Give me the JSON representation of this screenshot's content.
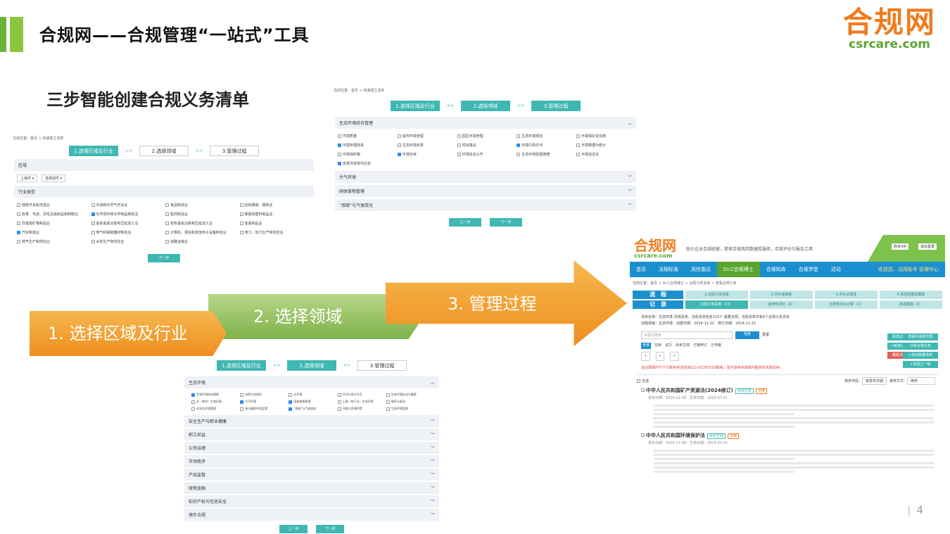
{
  "header": {
    "title": "合规网——合规管理“一站式”工具",
    "logo_cn": "合规网",
    "logo_en": "csrcare.com"
  },
  "subtitle": "三步智能创建合规义务清单",
  "page_number": "4",
  "chevrons": [
    "1. 选择区域及行业",
    "2. 选择领域",
    "3. 管理过程"
  ],
  "wizard": {
    "crumb": "当前位置：首页 > 快速建立清单",
    "steps": [
      "1.选择区域及行业",
      "2.选择领域",
      "3.管理过程"
    ],
    "arrow": ">>",
    "btn_prev": "上一步",
    "btn_next": "下一步"
  },
  "shot1": {
    "region_label": "区域",
    "province": "上海市",
    "city_placeholder": "选择城市",
    "industry_label": "行业类型",
    "industries": [
      {
        "label": "煤炭开采和洗选业",
        "checked": false
      },
      {
        "label": "石油和天然气开采业",
        "checked": false
      },
      {
        "label": "食品制造业",
        "checked": false
      },
      {
        "label": "纺织服装、服饰业",
        "checked": false
      },
      {
        "label": "皮革、毛皮、羽毛及其制品和制鞋业",
        "checked": false
      },
      {
        "label": "化学原料和化学制品制造业",
        "checked": true
      },
      {
        "label": "医药制造业",
        "checked": false
      },
      {
        "label": "橡胶和塑料制品业",
        "checked": false
      },
      {
        "label": "非金属矿物制品业",
        "checked": false
      },
      {
        "label": "黑色金属冶炼和压延加工业",
        "checked": false
      },
      {
        "label": "有色金属冶炼和压延加工业",
        "checked": false
      },
      {
        "label": "金属制品业",
        "checked": false
      },
      {
        "label": "汽车制造业",
        "checked": true
      },
      {
        "label": "电气机械和器材制造业",
        "checked": false
      },
      {
        "label": "计算机、通信和其他电子设备制造业",
        "checked": false
      },
      {
        "label": "电力、热力生产和供应业",
        "checked": false
      },
      {
        "label": "燃气生产和供应业",
        "checked": false
      },
      {
        "label": "水的生产和供应业",
        "checked": false
      },
      {
        "label": "道路运输业",
        "checked": false
      }
    ]
  },
  "shot2": {
    "sections": [
      "生态环境综合管理",
      "大气环境",
      "固体废物管理",
      "“双碳”与气候变化"
    ],
    "items": [
      {
        "label": "环境质量",
        "checked": false
      },
      {
        "label": "城市环境管理",
        "checked": false
      },
      {
        "label": "园区环境管理",
        "checked": false
      },
      {
        "label": "生态环境规划",
        "checked": false
      },
      {
        "label": "环境保护责任制",
        "checked": false
      },
      {
        "label": "环境管理体系",
        "checked": true
      },
      {
        "label": "生态环境目录",
        "checked": false
      },
      {
        "label": "项目建设",
        "checked": false
      },
      {
        "label": "环境行政许可",
        "checked": true
      },
      {
        "label": "环境数据与统计",
        "checked": false
      },
      {
        "label": "环境保护税",
        "checked": false
      },
      {
        "label": "环境信用",
        "checked": true
      },
      {
        "label": "环境信息公开",
        "checked": false
      },
      {
        "label": "生态环境损害赔偿",
        "checked": false
      },
      {
        "label": "环境信息化",
        "checked": false
      },
      {
        "label": "突发环境事件应急",
        "checked": true
      }
    ]
  },
  "shot3": {
    "sections": [
      "生态环境",
      "安全生产与职业健康",
      "职工权益",
      "公司治理",
      "市场秩序",
      "产品监管",
      "财税金融",
      "知识产权与信息安全",
      "境外合规"
    ],
    "items": [
      {
        "label": "生态环境综合管理",
        "checked": true
      },
      {
        "label": "自然生态保护",
        "checked": false
      },
      {
        "label": "水环境",
        "checked": false
      },
      {
        "label": "环评与排污许可",
        "checked": false
      },
      {
        "label": "生态环境执法与督察",
        "checked": false
      },
      {
        "label": "水（海洋）生态环境",
        "checked": false
      },
      {
        "label": "大气环境",
        "checked": true
      },
      {
        "label": "固体废物管理",
        "checked": true
      },
      {
        "label": "土壤（地下水）生态环境",
        "checked": false
      },
      {
        "label": "噪声与振动",
        "checked": false
      },
      {
        "label": "化学品环境管理",
        "checked": false
      },
      {
        "label": "核与辐射环境监管",
        "checked": false
      },
      {
        "label": "“双碳”与气候变化",
        "checked": true
      },
      {
        "label": "节能与资源利用",
        "checked": false
      },
      {
        "label": "生态环境监测",
        "checked": false
      }
    ]
  },
  "site": {
    "logo": "合规网",
    "logo_en": "csrcare.com",
    "slogan": "助力企业合规经营，提供合规风险数据库服务，合规评价与报告工具",
    "vip1": "购买VIP",
    "vip2": "退出登录",
    "nav": [
      "首页",
      "法规标准",
      "风险雷达",
      "Dr.C合规博士",
      "合规知库",
      "合规学堂",
      "活动"
    ],
    "nav_right": "欢迎您，试用账号 管理中心",
    "crumb": "当前位置：首页 > Dr.C合规博士 > 合规义务清单 > 查看合规义务",
    "flow_label": "流　程",
    "record_label": "记　录",
    "flow_steps": [
      "1.识别义务清单",
      "2.评价适用性",
      "3.评价合规性",
      "4.改进措施及跟踪"
    ],
    "record_tabs": [
      "合规义务清单（11）",
      "适用性评价（0）",
      "合规性评价记录（2）",
      "改进措施（0）"
    ],
    "list_title": "清单名称：生态环境 法规清单。当前清单包含115个 需要法规，当前清单共有6个合规义务清单",
    "meta": "创建领域：生态环境　创建日期：2024-11-22　修订日期：2024-11-22",
    "search_placeholder": "关键词搜索",
    "search_btn": "检索",
    "reset": "重置",
    "filters": [
      "全部",
      "在用",
      "试行",
      "尚未生效",
      "已被修订",
      "已作废"
    ],
    "actions": [
      "新增记录",
      "查看可适用法规",
      "+新增法规",
      "分析合规义务",
      "删除法规",
      "+添加批量清单",
      "+返回上一级"
    ],
    "notice": "请合规顾问于下方联系电话咨询021-62387550联系，您可获得专家顾问服务的实施支持。",
    "sort_label": "排序字段：",
    "sort_value": "按发布日期",
    "order_label": "排序方式：",
    "order_value": "倒序",
    "select_all": "全选",
    "laws": [
      {
        "title": "中华人民共和国矿产资源法(2024修订)",
        "tag1": "尚未生效",
        "tag2": "法律",
        "date": "发布日期：2024-11-08　生效日期：2025-07-01"
      },
      {
        "title": "中华人民共和国环境保护法",
        "tag1": "尚未生效",
        "tag2": "法律",
        "date": "发布日期：2024-11-08　生效日期：2025-01-01"
      }
    ]
  }
}
